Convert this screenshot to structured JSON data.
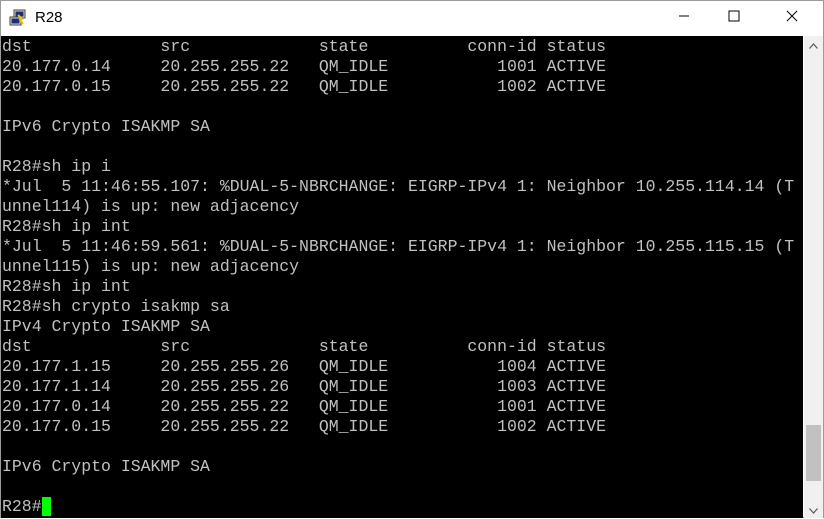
{
  "window": {
    "title": "R28"
  },
  "terminal": {
    "lines": [
      "dst             src             state          conn-id status",
      "20.177.0.14     20.255.255.22   QM_IDLE           1001 ACTIVE",
      "20.177.0.15     20.255.255.22   QM_IDLE           1002 ACTIVE",
      "",
      "IPv6 Crypto ISAKMP SA",
      "",
      "R28#sh ip i",
      "*Jul  5 11:46:55.107: %DUAL-5-NBRCHANGE: EIGRP-IPv4 1: Neighbor 10.255.114.14 (T",
      "unnel114) is up: new adjacency",
      "R28#sh ip int",
      "*Jul  5 11:46:59.561: %DUAL-5-NBRCHANGE: EIGRP-IPv4 1: Neighbor 10.255.115.15 (T",
      "unnel115) is up: new adjacency",
      "R28#sh ip int",
      "R28#sh crypto isakmp sa",
      "IPv4 Crypto ISAKMP SA",
      "dst             src             state          conn-id status",
      "20.177.1.15     20.255.255.26   QM_IDLE           1004 ACTIVE",
      "20.177.1.14     20.255.255.26   QM_IDLE           1003 ACTIVE",
      "20.177.0.14     20.255.255.22   QM_IDLE           1001 ACTIVE",
      "20.177.0.15     20.255.255.22   QM_IDLE           1002 ACTIVE",
      "",
      "IPv6 Crypto ISAKMP SA",
      ""
    ],
    "prompt": "R28#"
  },
  "scrollbar": {
    "position": 0.95
  },
  "icons": {
    "app": "putty-icon",
    "minimize": "minimize-icon",
    "maximize": "maximize-icon",
    "close": "close-icon"
  },
  "colors": {
    "terminal_bg": "#000000",
    "terminal_fg": "#c0c0c0",
    "cursor": "#00ff00"
  }
}
